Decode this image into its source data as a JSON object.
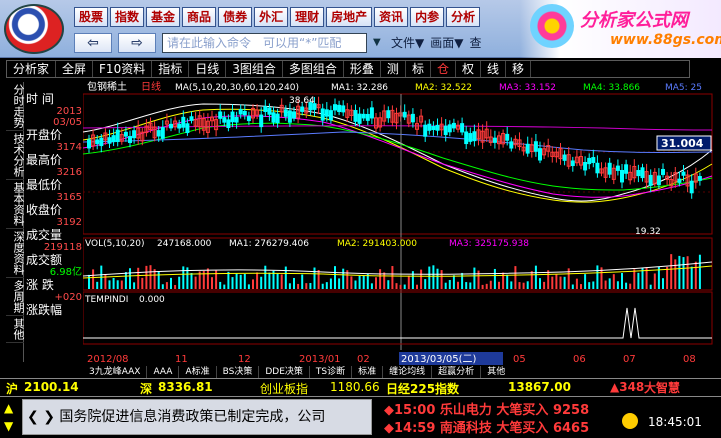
{
  "top_menu": [
    "股票",
    "指数",
    "基金",
    "商品",
    "债券",
    "外汇",
    "理财",
    "房地产",
    "资讯",
    "内参",
    "分析"
  ],
  "nav": {
    "back": "⇦",
    "forward": "⇨",
    "command_placeholder": "请在此输入命令　可以用“*”匹配",
    "file": "文件▼",
    "picture": "画面▼",
    "search": "查"
  },
  "brand": {
    "name": "分析家公式网",
    "url": "www.88gs.com"
  },
  "toolbar": [
    "分析家",
    "全屏",
    "F10资料",
    "指标",
    "日线",
    "3图组合",
    "多图组合",
    "形叠",
    "测",
    "标",
    "仓",
    "权",
    "线",
    "移"
  ],
  "vtabs": [
    "分时走势",
    "技术分析",
    "基本资料",
    "深度资料",
    "多周期",
    "其他"
  ],
  "info": [
    {
      "label": "时 间",
      "value": "",
      "value2": ""
    },
    {
      "label": "",
      "value": "2013",
      "value2": "03/05"
    },
    {
      "label": "开盘价",
      "value": "3174",
      "value2": ""
    },
    {
      "label": "最高价",
      "value": "3216",
      "value2": ""
    },
    {
      "label": "最低价",
      "value": "3165",
      "value2": ""
    },
    {
      "label": "收盘价",
      "value": "3192",
      "value2": ""
    },
    {
      "label": "成交量",
      "value": "219118",
      "value2": ""
    },
    {
      "label": "成交额",
      "value": "6.98亿",
      "value2": ""
    },
    {
      "label": "涨 跌",
      "value": "+020",
      "value2": ""
    },
    {
      "label": "涨跌幅",
      "value": "",
      "value2": ""
    }
  ],
  "chart_header": {
    "stock": "包钢稀土",
    "period": "日线",
    "ma_def": "MA(5,10,20,30,60,120,240)",
    "ma1": "MA1: 32.286",
    "ma2": "MA2: 32.522",
    "ma3": "MA3: 33.152",
    "ma4": "MA4: 33.866",
    "ma5": "MA5: 25"
  },
  "chart_labels": {
    "high": "38.64",
    "low": "19.32",
    "last": "31.004"
  },
  "vol_header": {
    "def": "VOL(5,10,20)",
    "v": "247168.000",
    "ma1": "MA1: 276279.406",
    "ma2": "MA2: 291403.000",
    "ma3": "MA3: 325175.938"
  },
  "temp_header": {
    "def": "TEMPINDI",
    "v": "0.000"
  },
  "date_axis": [
    "2012/08",
    "11",
    "12",
    "2013/01",
    "02",
    "2013/03/05(二)",
    "05",
    "06",
    "07",
    "08"
  ],
  "bottom_tabs": [
    "3九龙峰AAX",
    "AAA",
    "A标准",
    "BS决策",
    "DDE决策",
    "TS诊断",
    "标准",
    "缠论均线",
    "超赢分析",
    "其他"
  ],
  "ticker": {
    "sh_label": "沪",
    "sh": "2100.14",
    "sz_label": "深",
    "sz": "8336.81",
    "board": "创业板指",
    "board_val": "1180.66",
    "nk": "日经225指数",
    "nk_val": "13867.00",
    "chg": "▲348"
  },
  "news": "国务院促进信息消费政策已制定完成，公司",
  "alerts": [
    "◆15:00 乐山电力 大笔买入 9258",
    "◆14:59 南通科技 大笔买入 6465"
  ],
  "clock": "18:45:01",
  "app_badge": "大智慧",
  "colors": {
    "up": "#ff3a3a",
    "down": "#00ffff",
    "ma1": "#ffffff",
    "ma2": "#ffff00",
    "ma3": "#ff00ff",
    "ma4": "#00ff00",
    "ma5": "#5a7bff"
  }
}
